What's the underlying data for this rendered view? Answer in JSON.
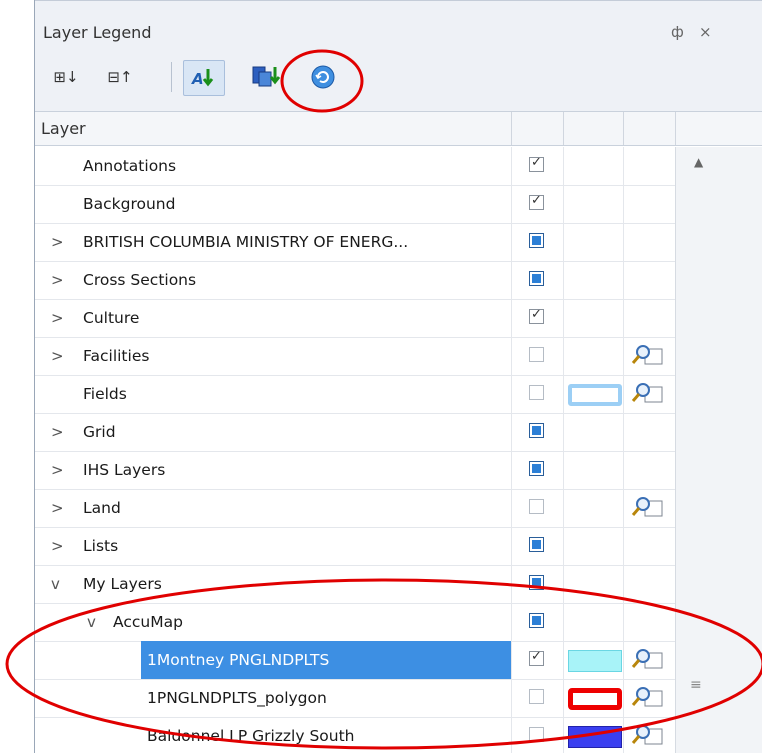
{
  "window": {
    "title": "Layer Legend",
    "pin_glyph": "ф",
    "close_glyph": "×"
  },
  "toolbar": {
    "expand_all": "⊞↓",
    "collapse_all": "⊟↑",
    "buttons": [
      "sort-ab-icon",
      "layers-order-icon",
      "refresh-icon"
    ]
  },
  "grid": {
    "header": {
      "layer": "Layer"
    },
    "rows": [
      {
        "name": "Annotations",
        "expander": "",
        "check": "checked",
        "swatch": "",
        "zoom": false
      },
      {
        "name": "Background",
        "expander": "",
        "check": "checked",
        "swatch": "",
        "zoom": false
      },
      {
        "name": "BRITISH COLUMBIA MINISTRY OF ENERG...",
        "expander": ">",
        "check": "partial",
        "swatch": "",
        "zoom": false
      },
      {
        "name": "Cross Sections",
        "expander": ">",
        "check": "partial",
        "swatch": "",
        "zoom": false
      },
      {
        "name": "Culture",
        "expander": ">",
        "check": "checked",
        "swatch": "",
        "zoom": false
      },
      {
        "name": "Facilities",
        "expander": ">",
        "check": "empty",
        "swatch": "",
        "zoom": true
      },
      {
        "name": "Fields",
        "expander": "",
        "check": "empty",
        "swatch": "light",
        "zoom": true
      },
      {
        "name": "Grid",
        "expander": ">",
        "check": "partial",
        "swatch": "",
        "zoom": false
      },
      {
        "name": "IHS Layers",
        "expander": ">",
        "check": "partial",
        "swatch": "",
        "zoom": false
      },
      {
        "name": "Land",
        "expander": ">",
        "check": "empty",
        "swatch": "",
        "zoom": true
      },
      {
        "name": "Lists",
        "expander": ">",
        "check": "partial",
        "swatch": "",
        "zoom": false
      },
      {
        "name": "My Layers",
        "expander": "v",
        "check": "partial",
        "swatch": "",
        "zoom": false
      },
      {
        "name": "AccuMap",
        "expander": "v",
        "check": "partial",
        "swatch": "",
        "zoom": false
      },
      {
        "name": "1Montney PNGLNDPLTS",
        "expander": "",
        "check": "checked",
        "swatch": "cyan",
        "zoom": true,
        "selected": true
      },
      {
        "name": "1PNGLNDPLTS_polygon",
        "expander": "",
        "check": "empty",
        "swatch": "red",
        "zoom": true
      },
      {
        "name": "Baldonnel LP Grizzly South",
        "expander": "",
        "check": "empty",
        "swatch": "blue",
        "zoom": true
      }
    ]
  },
  "scrollbar": {
    "up": "▲",
    "grip": "≡"
  },
  "colors": {
    "accent": "#3d8fe3",
    "highlight_ellipse": "#e00000"
  }
}
